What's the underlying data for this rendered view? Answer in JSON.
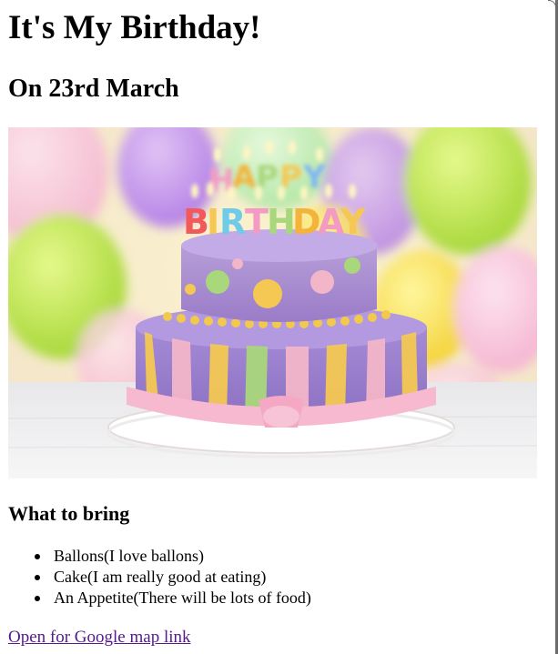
{
  "page": {
    "title": "It's My Birthday!",
    "date_heading": "On 23rd March",
    "bring_heading": "What to bring",
    "bring_items": [
      "Ballons(I love ballons)",
      "Cake(I am really good at eating)",
      "An Appetite(There will be lots of food)"
    ],
    "map_link_label": "Open for Google map link"
  },
  "image": {
    "subject": "birthday-cake-photo",
    "candle_letters_top": "HAPPY",
    "candle_letters_bottom": "BIRTHDAY"
  },
  "colors": {
    "link_visited": "#551a8b",
    "text": "#000000",
    "background": "#ffffff"
  }
}
